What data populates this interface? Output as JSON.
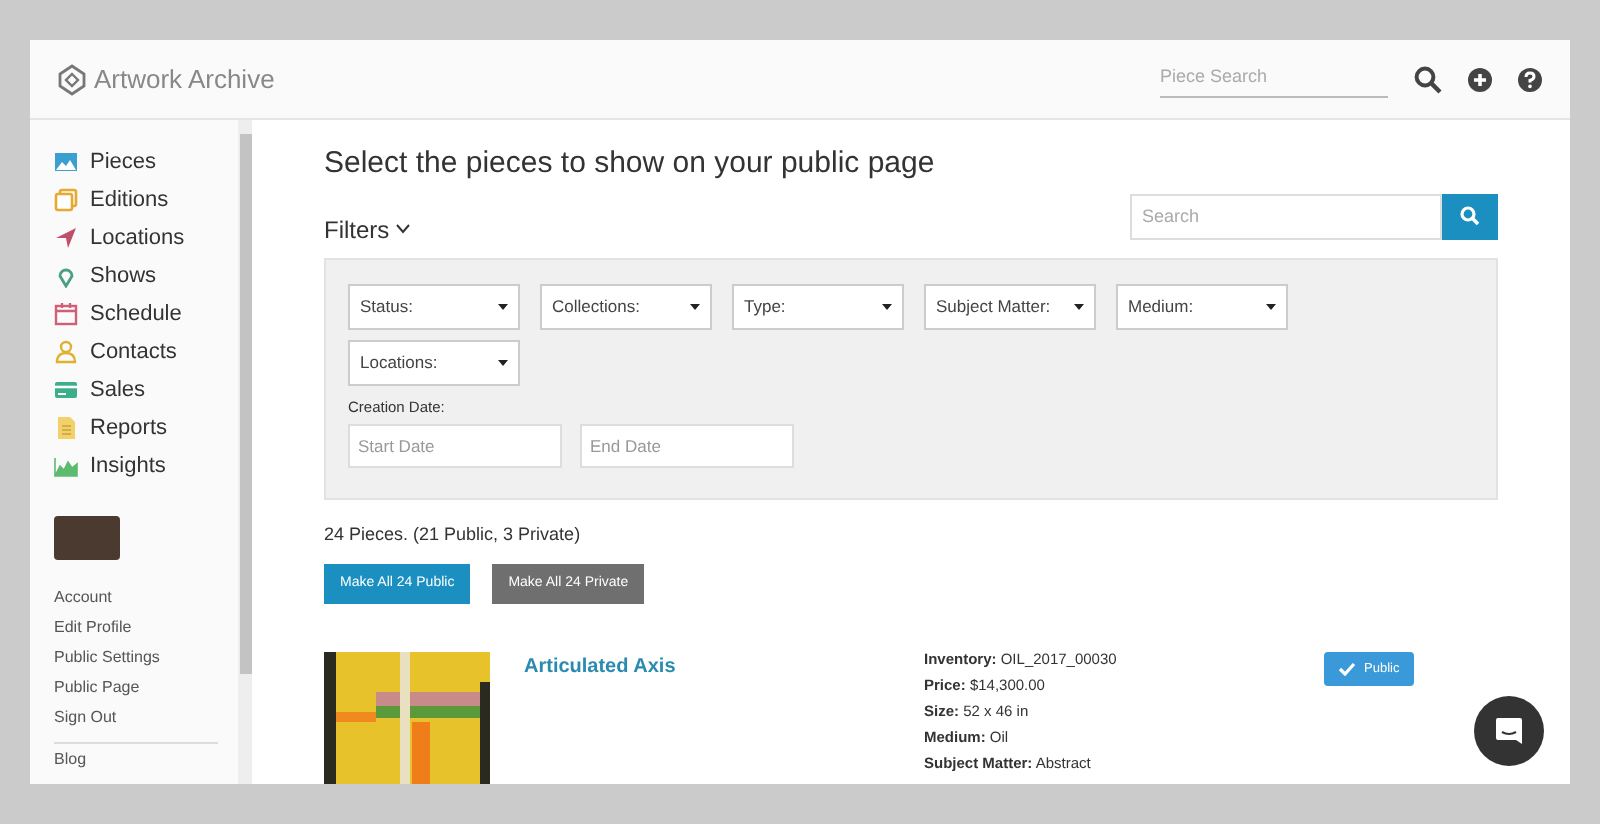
{
  "header": {
    "logo_text": "Artwork Archive",
    "search": {
      "placeholder": "Piece Search"
    }
  },
  "sidebar": {
    "nav": [
      {
        "label": "Pieces"
      },
      {
        "label": "Editions"
      },
      {
        "label": "Locations"
      },
      {
        "label": "Shows"
      },
      {
        "label": "Schedule"
      },
      {
        "label": "Contacts"
      },
      {
        "label": "Sales"
      },
      {
        "label": "Reports"
      },
      {
        "label": "Insights"
      }
    ],
    "account_links": [
      "Account",
      "Edit Profile",
      "Public Settings",
      "Public Page",
      "Sign Out"
    ],
    "footer_links": [
      "Blog"
    ]
  },
  "main": {
    "title": "Select the pieces to show on your public page",
    "filters_label": "Filters",
    "search": {
      "placeholder": "Search"
    },
    "dropdowns": [
      "Status:",
      "Collections:",
      "Type:",
      "Subject Matter:",
      "Medium:",
      "Locations:"
    ],
    "creation_date": {
      "label": "Creation Date:",
      "start": {
        "placeholder": "Start Date"
      },
      "end": {
        "placeholder": "End Date"
      }
    },
    "summary": "24 Pieces. (21 Public, 3 Private)",
    "buttons": [
      {
        "label": "Make All 24 Public",
        "kind": "primary"
      },
      {
        "label": "Make All 24 Private",
        "kind": "secondary"
      }
    ],
    "pieces": [
      {
        "title": "Articulated Axis",
        "details": [
          {
            "label": "Inventory:",
            "value": "OIL_2017_00030"
          },
          {
            "label": "Price:",
            "value": "$14,300.00"
          },
          {
            "label": "Size:",
            "value": "52 x 46 in"
          },
          {
            "label": "Medium:",
            "value": "Oil"
          },
          {
            "label": "Subject Matter:",
            "value": "Abstract"
          }
        ],
        "visibility": "Public",
        "public": true
      }
    ]
  }
}
